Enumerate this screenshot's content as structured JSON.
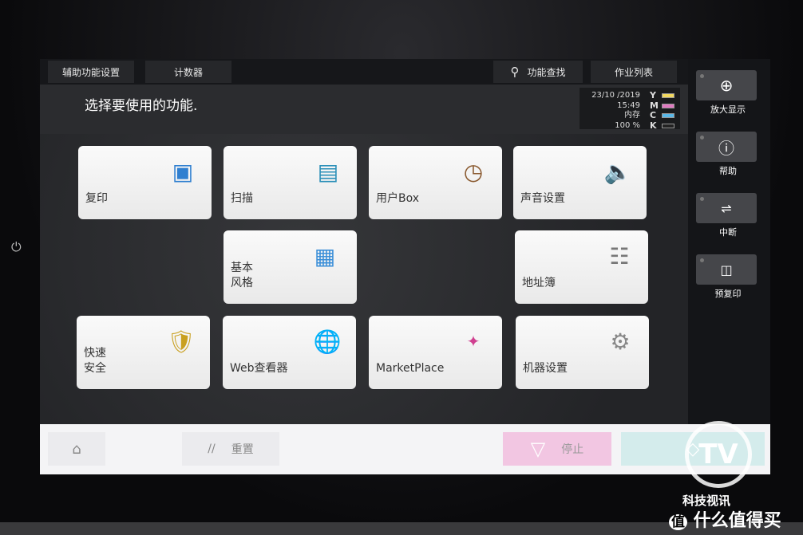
{
  "topbar": {
    "tabs": [
      {
        "label": "辅助功能设置"
      },
      {
        "label": "计数器"
      },
      {
        "label": "功能查找",
        "icon": "search-icon"
      },
      {
        "label": "作业列表"
      }
    ]
  },
  "title": "选择要使用的功能.",
  "status": {
    "date": "23/10 /2019",
    "time": "15:49",
    "memory_label": "内存",
    "memory_value": "100 %",
    "inks": [
      {
        "letter": "Y",
        "color": "#f2d860"
      },
      {
        "letter": "M",
        "color": "#e07ac0"
      },
      {
        "letter": "C",
        "color": "#5ab8e8"
      },
      {
        "letter": "K",
        "color": "#222222"
      }
    ]
  },
  "right_panel": [
    {
      "label": "放大显示",
      "icon": "zoom-in-icon"
    },
    {
      "label": "帮助",
      "icon": "help-icon"
    },
    {
      "label": "中断",
      "icon": "interrupt-icon"
    },
    {
      "label": "预复印",
      "icon": "preview-icon"
    }
  ],
  "tiles": [
    {
      "label": "复印",
      "icon": "copy-icon"
    },
    {
      "label": "扫描",
      "icon": "scan-icon"
    },
    {
      "label": "用户Box",
      "icon": "user-box-icon"
    },
    {
      "label": "声音设置",
      "icon": "sound-icon"
    },
    {
      "label": "基本\n风格",
      "icon": "basic-style-icon"
    },
    {
      "label": "地址簿",
      "icon": "address-book-icon"
    },
    {
      "label": "快速\n安全",
      "icon": "quick-security-icon"
    },
    {
      "label": "Web查看器",
      "icon": "globe-icon"
    },
    {
      "label": "MarketPlace",
      "icon": "marketplace-icon"
    },
    {
      "label": "机器设置",
      "icon": "gear-icon"
    }
  ],
  "bottombar": {
    "home_icon": "home-icon",
    "reset": "重置",
    "stop": "停止",
    "start_icon": "start-icon",
    "stop_color": "#f2c6e2",
    "start_color": "#d4ecec"
  },
  "watermark": {
    "line1": "科技视讯",
    "line2": "什么值得买",
    "badge": "值"
  }
}
